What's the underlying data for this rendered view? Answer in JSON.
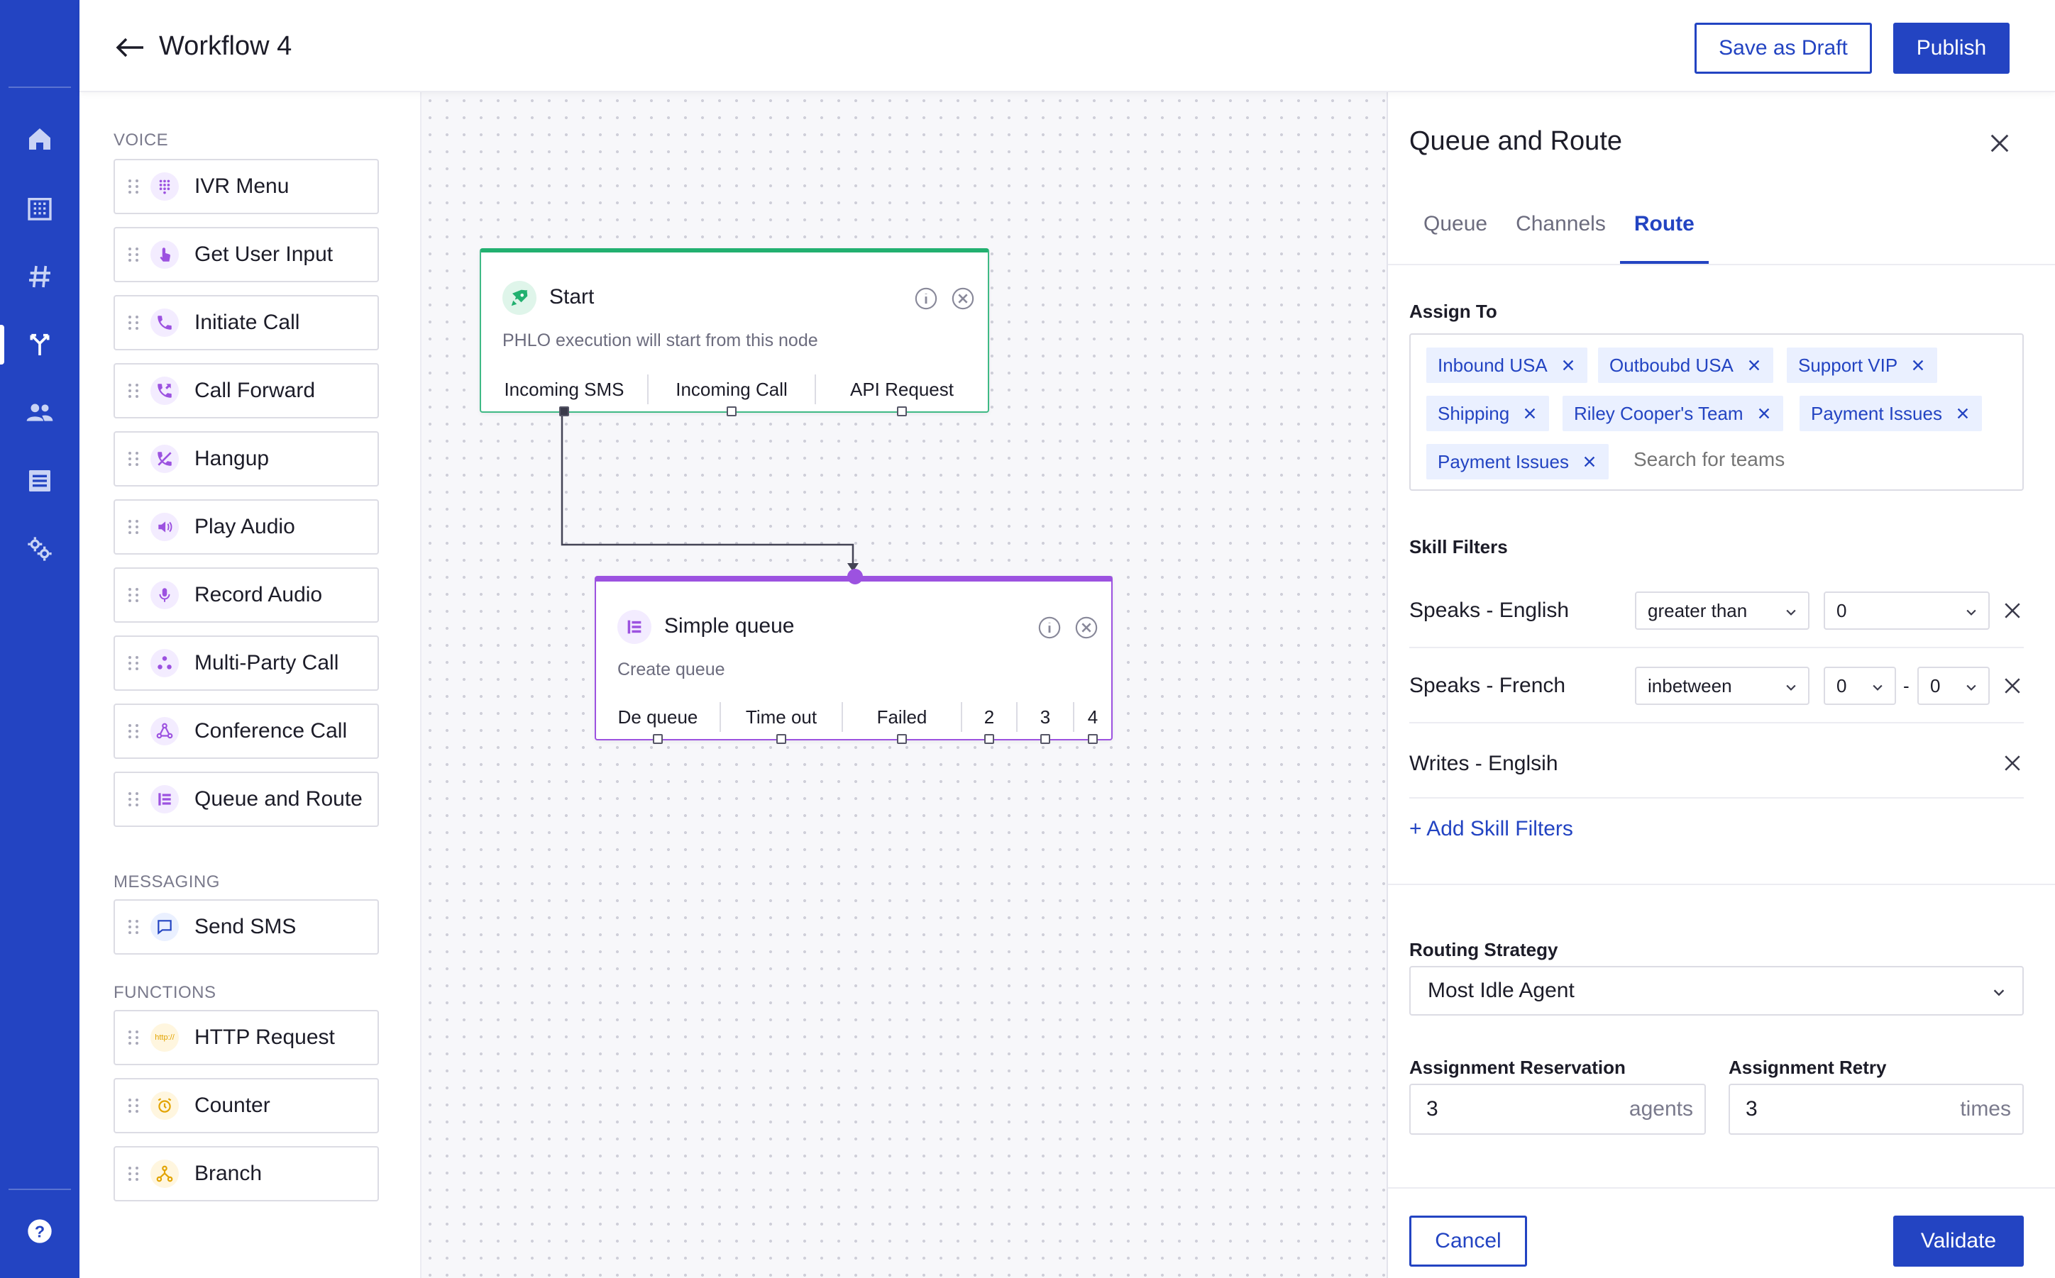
{
  "header": {
    "title": "Workflow 4",
    "save_draft_label": "Save as Draft",
    "publish_label": "Publish"
  },
  "nav_rail": {
    "items": [
      "home-icon",
      "building-icon",
      "hash-icon",
      "workflow-icon",
      "users-icon",
      "list-icon",
      "settings-icon"
    ],
    "active": "workflow-icon",
    "help_icon": "help-icon"
  },
  "palette": {
    "sections": [
      {
        "label": "VOICE",
        "items": [
          {
            "label": "IVR Menu",
            "icon": "dialpad-icon"
          },
          {
            "label": "Get User Input",
            "icon": "touch-icon"
          },
          {
            "label": "Initiate Call",
            "icon": "phone-icon"
          },
          {
            "label": "Call Forward",
            "icon": "phone-forward-icon"
          },
          {
            "label": "Hangup",
            "icon": "hangup-icon"
          },
          {
            "label": "Play Audio",
            "icon": "speaker-icon"
          },
          {
            "label": "Record Audio",
            "icon": "microphone-icon"
          },
          {
            "label": "Multi-Party Call",
            "icon": "multi-party-icon"
          },
          {
            "label": "Conference Call",
            "icon": "conference-icon"
          },
          {
            "label": "Queue and Route",
            "icon": "queue-icon"
          }
        ]
      },
      {
        "label": "MESSAGING",
        "items": [
          {
            "label": "Send SMS",
            "icon": "message-icon"
          }
        ]
      },
      {
        "label": "FUNCTIONS",
        "items": [
          {
            "label": "HTTP Request",
            "icon": "http-icon",
            "icon_text": "http://"
          },
          {
            "label": "Counter",
            "icon": "counter-icon"
          },
          {
            "label": "Branch",
            "icon": "branch-icon"
          }
        ]
      }
    ]
  },
  "canvas": {
    "start_node": {
      "title": "Start",
      "subtitle": "PHLO execution will start from this node",
      "outputs": [
        "Incoming SMS",
        "Incoming Call",
        "API Request"
      ]
    },
    "queue_node": {
      "title": "Simple queue",
      "subtitle": "Create queue",
      "outputs": [
        "De queue",
        "Time out",
        "Failed",
        "2",
        "3",
        "4"
      ]
    }
  },
  "panel": {
    "title": "Queue and Route",
    "tabs": [
      "Queue",
      "Channels",
      "Route"
    ],
    "active_tab": "Route",
    "assign_to": {
      "label": "Assign To",
      "tags": [
        "Inbound USA",
        "Outboubd USA",
        "Support VIP",
        "Shipping",
        "Riley Cooper's Team",
        "Payment Issues",
        "Payment Issues"
      ],
      "search_placeholder": "Search for teams"
    },
    "skill_filters": {
      "label": "Skill Filters",
      "rows": [
        {
          "name": "Speaks - English",
          "operator": "greater than",
          "values": [
            "0"
          ]
        },
        {
          "name": "Speaks - French",
          "operator": "inbetween",
          "values": [
            "0",
            "0"
          ],
          "separator": "-"
        },
        {
          "name": "Writes - Englsih"
        }
      ],
      "add_label": "+ Add Skill Filters"
    },
    "routing_strategy": {
      "label": "Routing Strategy",
      "value": "Most Idle Agent"
    },
    "assignment_reservation": {
      "label": "Assignment Reservation",
      "value": "3",
      "unit": "agents"
    },
    "assignment_retry": {
      "label": "Assignment Retry",
      "value": "3",
      "unit": "times"
    },
    "cancel_label": "Cancel",
    "validate_label": "Validate"
  },
  "colors": {
    "brand": "#2344c2",
    "start_accent": "#22b070",
    "queue_accent": "#9c52e0",
    "tag_bg": "#eaf0ff"
  }
}
